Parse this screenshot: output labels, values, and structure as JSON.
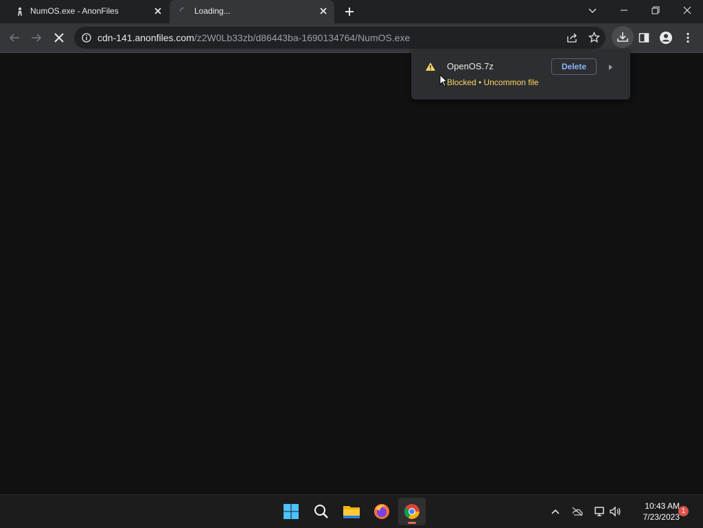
{
  "tabs": [
    {
      "title": "NumOS.exe - AnonFiles",
      "active": false
    },
    {
      "title": "Loading...",
      "active": true
    }
  ],
  "address_bar": {
    "host": "cdn-141.anonfiles.com",
    "path": "/z2W0Lb33zb/d86443ba-1690134764/NumOS.exe"
  },
  "download_bubble": {
    "filename": "OpenOS.7z",
    "status": "Blocked • Uncommon file",
    "delete_label": "Delete"
  },
  "taskbar": {
    "apps": [
      "windows-start",
      "search",
      "file-explorer",
      "firefox",
      "chrome"
    ],
    "active_app": "chrome"
  },
  "clock": {
    "time": "10:43 AM",
    "date": "7/23/2023"
  },
  "notifications": {
    "count": "1"
  },
  "colors": {
    "tabstrip_bg": "#202124",
    "toolbar_bg": "#35363a",
    "page_bg": "#111111",
    "warning": "#fdd663",
    "link_blue": "#8ab4f8"
  }
}
